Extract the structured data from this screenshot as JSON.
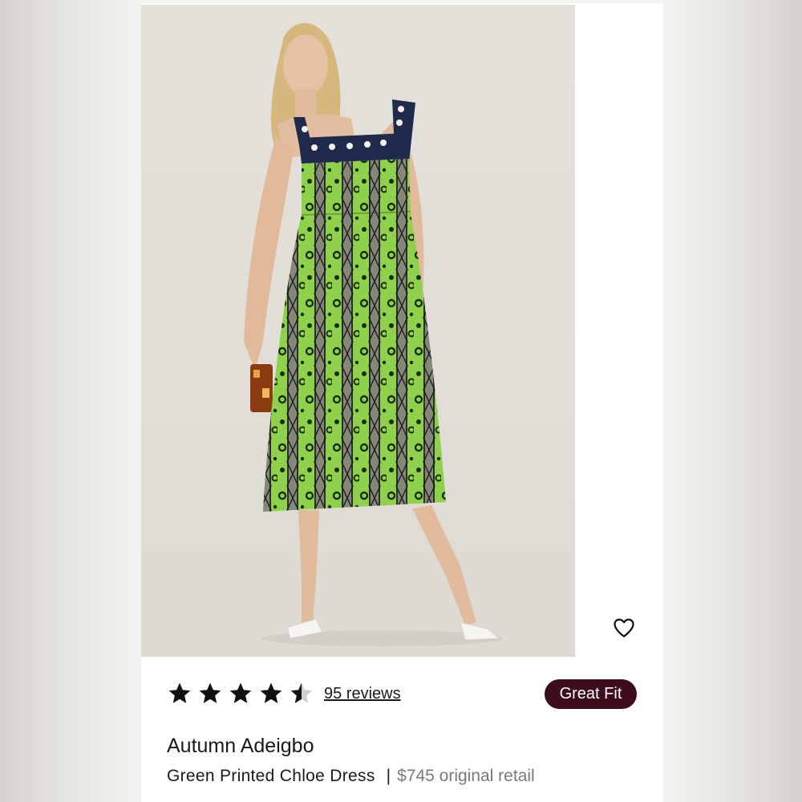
{
  "product": {
    "image_alt": "Model wearing green printed dress",
    "rating": 4.5,
    "rating_max": 5,
    "reviews_label": "95 reviews",
    "fit_badge": "Great Fit",
    "designer": "Autumn Adeigbo",
    "name": "Green Printed Chloe Dress",
    "separator": "|",
    "price_label": "$745 original retail"
  },
  "icons": {
    "favorite": "heart-outline-icon",
    "rating": "star-icon"
  },
  "colors": {
    "badge_bg": "#3d0c1e",
    "badge_text": "#ffffff",
    "star": "#111111",
    "price": "#7a7a7a",
    "dress_green": "#7cc242",
    "dress_navy": "#1f2a4d"
  }
}
